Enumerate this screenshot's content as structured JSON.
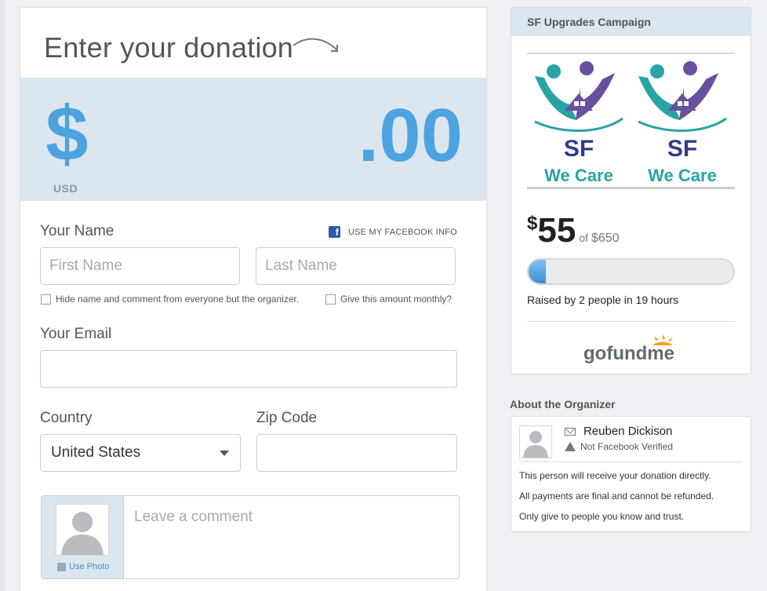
{
  "donation": {
    "heading": "Enter your donation",
    "currency_symbol": "$",
    "currency_code": "USD",
    "cents": ".00"
  },
  "form": {
    "name_label": "Your Name",
    "facebook_link": "USE MY FACEBOOK INFO",
    "facebook_icon_letter": "f",
    "first_name_placeholder": "First Name",
    "last_name_placeholder": "Last Name",
    "hide_name_label": "Hide name and comment from everyone but the organizer.",
    "monthly_label": "Give this amount monthly?",
    "email_label": "Your Email",
    "country_label": "Country",
    "country_value": "United States",
    "zip_label": "Zip Code",
    "comment_placeholder": "Leave a comment",
    "use_photo_label": "Use Photo"
  },
  "campaign": {
    "title": "SF Upgrades Campaign",
    "logo_line1": "SF",
    "logo_line2": "We Care",
    "raised_currency": "$",
    "raised_amount": "55",
    "raised_of": "of",
    "goal": "$650",
    "progress_fraction": 0.085,
    "raised_by_text": "Raised by 2 people in 19 hours",
    "brand": "gofundme"
  },
  "organizer": {
    "section_title": "About the Organizer",
    "name": "Reuben Dickison",
    "verification": "Not Facebook Verified",
    "notes": [
      "This person will receive your donation directly.",
      "All payments are final and cannot be refunded.",
      "Only give to people you know and trust."
    ]
  },
  "colors": {
    "accent_blue": "#4da3e0",
    "band_bg": "#dbe6ef",
    "facebook_blue": "#2f5aa8"
  }
}
